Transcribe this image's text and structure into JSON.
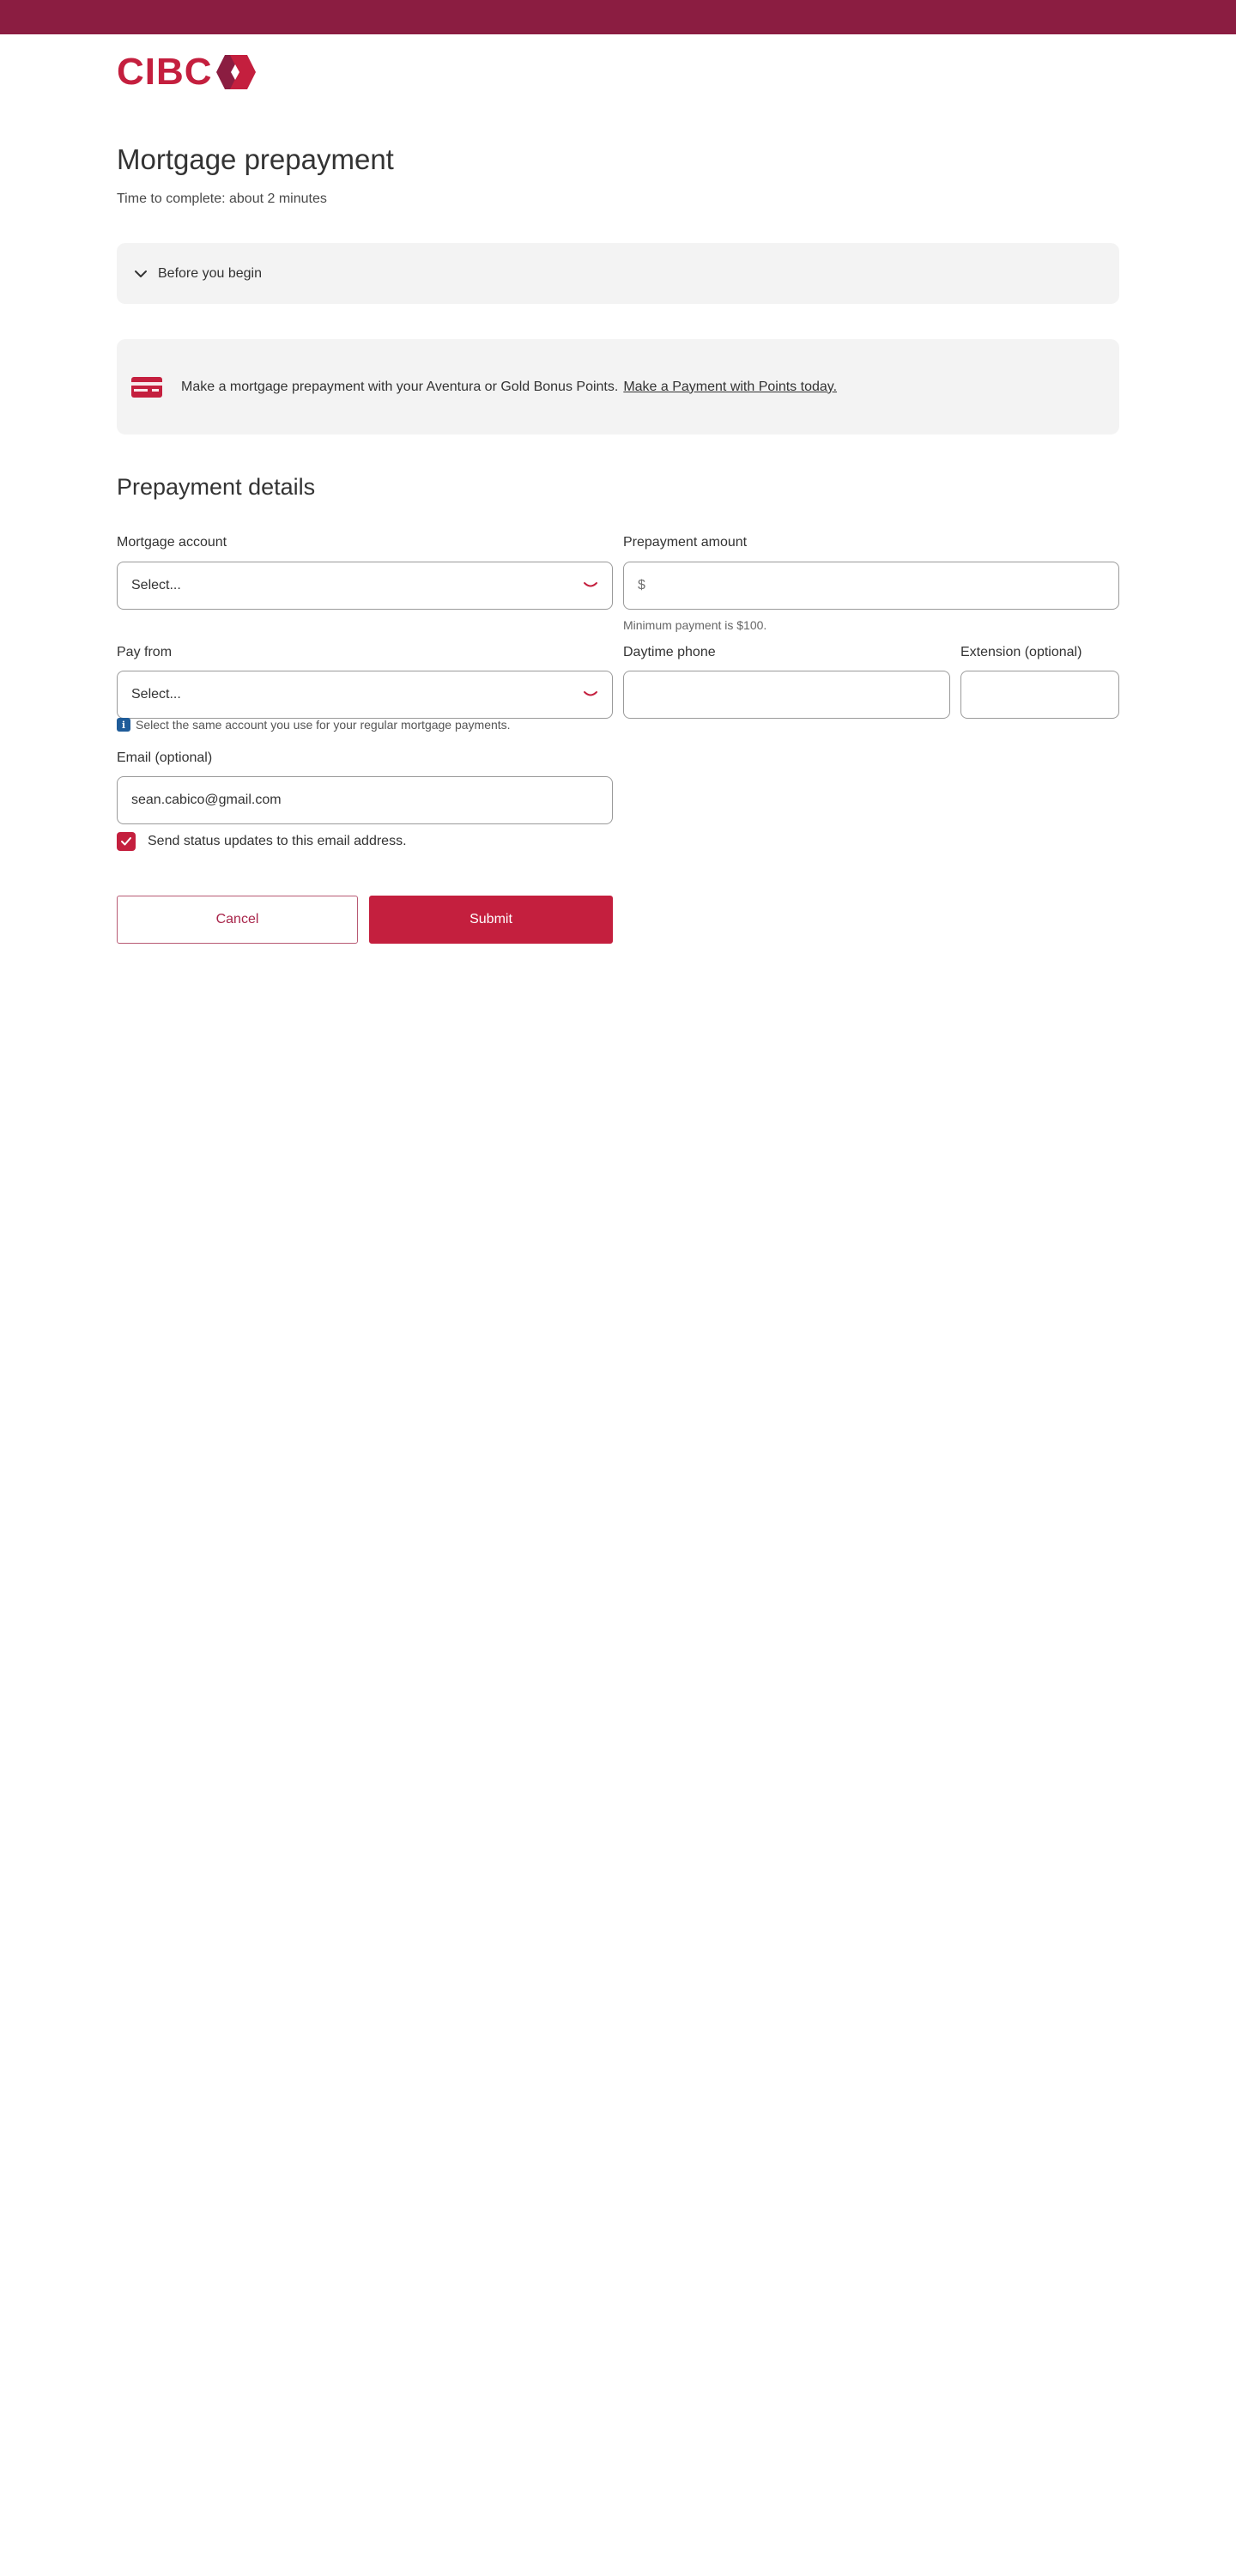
{
  "brand": {
    "logo_text": "CIBC",
    "primary_color": "#c41f3e",
    "top_bar_color": "#8b1d41"
  },
  "page": {
    "title": "Mortgage prepayment",
    "subtitle": "Time to complete: about 2 minutes"
  },
  "accordion": {
    "label": "Before you begin",
    "icon": "chevron-down-icon"
  },
  "promo": {
    "icon": "credit-card-icon",
    "text": "Make a mortgage prepayment with your Aventura or Gold Bonus Points.",
    "link_text": "Make a Payment with Points today."
  },
  "section": {
    "title": "Prepayment details"
  },
  "form": {
    "mortgage_account": {
      "label": "Mortgage account",
      "value": "Select..."
    },
    "prepayment_amount": {
      "label": "Prepayment amount",
      "prefix": "$",
      "helper": "Minimum payment is $100."
    },
    "pay_from": {
      "label": "Pay from",
      "value": "Select...",
      "info": "Select the same account you use for your regular mortgage payments."
    },
    "daytime_phone": {
      "label": "Daytime phone",
      "value": ""
    },
    "extension": {
      "label": "Extension (optional)",
      "value": ""
    },
    "email": {
      "label": "Email (optional)",
      "value": "sean.cabico@gmail.com"
    },
    "status_updates": {
      "label": "Send status updates to this email address.",
      "checked": true
    }
  },
  "actions": {
    "cancel_label": "Cancel",
    "submit_label": "Submit"
  }
}
